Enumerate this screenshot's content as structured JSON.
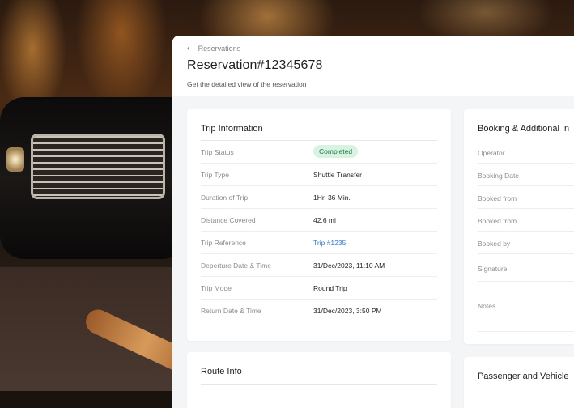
{
  "breadcrumb": {
    "label": "Reservations"
  },
  "page": {
    "title": "Reservation#12345678",
    "subtitle": "Get the detailed view of the reservation"
  },
  "trip": {
    "title": "Trip Information",
    "rows": [
      {
        "label": "Trip Status",
        "value": "Completed",
        "kind": "badge"
      },
      {
        "label": "Trip Type",
        "value": "Shuttle Transfer",
        "kind": "text"
      },
      {
        "label": "Duration of Trip",
        "value": "1Hr. 36 Min.",
        "kind": "text"
      },
      {
        "label": "Distance Covered",
        "value": "42.6 mi",
        "kind": "text"
      },
      {
        "label": "Trip Reference",
        "value": "Trip #1235",
        "kind": "link"
      },
      {
        "label": "Deperture Date & Time",
        "value": "31/Dec/2023, 11:10 AM",
        "kind": "text"
      },
      {
        "label": "Trip Mode",
        "value": "Round Trip",
        "kind": "text"
      },
      {
        "label": "Return Date & Time",
        "value": "31/Dec/2023, 3:50 PM",
        "kind": "text"
      }
    ]
  },
  "route": {
    "title": "Route Info"
  },
  "booking": {
    "title": "Booking & Additional In",
    "rows": [
      {
        "label": "Operator"
      },
      {
        "label": "Booking Date"
      },
      {
        "label": "Booked from"
      },
      {
        "label": "Booked from"
      },
      {
        "label": "Booked by"
      },
      {
        "label": "Signature"
      },
      {
        "label": "Notes"
      }
    ]
  },
  "passenger": {
    "title": "Passenger and Vehicle"
  },
  "colors": {
    "badge_bg": "#d9f3e3",
    "badge_text": "#1f7a45",
    "link": "#2f7fe0"
  },
  "icons": {
    "back": "chevron-left-icon"
  }
}
